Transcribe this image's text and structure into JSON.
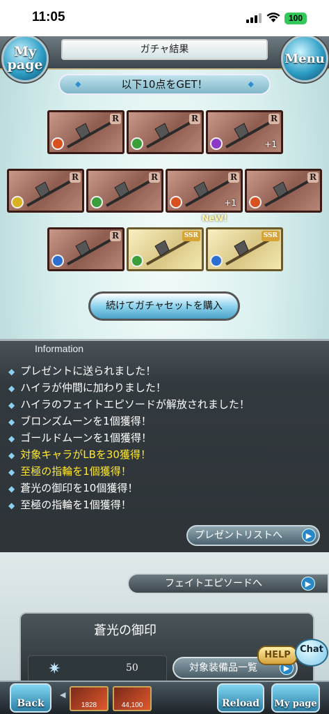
{
  "status_bar": {
    "time": "11:05",
    "battery": "100"
  },
  "header": {
    "title": "ガチャ結果",
    "mypage_label": "My page",
    "menu_label": "Menu"
  },
  "subheading": "以下10点をGET！",
  "items": [
    {
      "rarity": "R",
      "element": "fire",
      "plus": ""
    },
    {
      "rarity": "R",
      "element": "wind",
      "plus": ""
    },
    {
      "rarity": "R",
      "element": "dark",
      "plus": "+1"
    },
    {
      "rarity": "R",
      "element": "light",
      "plus": ""
    },
    {
      "rarity": "R",
      "element": "wind",
      "plus": ""
    },
    {
      "rarity": "R",
      "element": "fire",
      "plus": "+1"
    },
    {
      "rarity": "R",
      "element": "fire",
      "plus": ""
    },
    {
      "rarity": "R",
      "element": "water",
      "plus": ""
    },
    {
      "rarity": "SSR",
      "element": "wind",
      "plus": ""
    },
    {
      "rarity": "SSR",
      "element": "water",
      "plus": ""
    }
  ],
  "new_tag": "NeW!",
  "buy_again_label": "続けてガチャセットを購入",
  "information": {
    "heading": "Information",
    "lines": [
      {
        "text": "プレゼントに送られました！",
        "highlight": false
      },
      {
        "text": "ハイラが仲間に加わりました！",
        "highlight": false
      },
      {
        "text": "ハイラのフェイトエピソードが解放されました！",
        "highlight": false
      },
      {
        "text": "ブロンズムーンを1個獲得！",
        "highlight": false
      },
      {
        "text": "ゴールドムーンを1個獲得！",
        "highlight": false
      },
      {
        "text": "対象キャラがLBを30獲得！",
        "highlight": true
      },
      {
        "text": "至極の指輪を1個獲得！",
        "highlight": true
      },
      {
        "text": "蒼光の御印を10個獲得！",
        "highlight": false
      },
      {
        "text": "至極の指輪を1個獲得！",
        "highlight": false
      }
    ],
    "present_list_label": "プレゼントリストへ"
  },
  "fate_episode_label": "フェイトエピソードへ",
  "panel": {
    "title": "蒼光の御印",
    "count": "50",
    "target_equipment_label": "対象装備品一覧",
    "help_label": "HELP",
    "chat_label": "Chat"
  },
  "footer": {
    "back_label": "Back",
    "reload_label": "Reload",
    "mypage_label": "My page",
    "thumb1_value": "1828",
    "thumb2_value": "44,100"
  },
  "colors": {
    "fire": "#d9511f",
    "wind": "#3a9e3a",
    "dark": "#8a3ac7",
    "light": "#d9b21f",
    "water": "#2d6fd1",
    "highlight": "#ffe82e"
  }
}
